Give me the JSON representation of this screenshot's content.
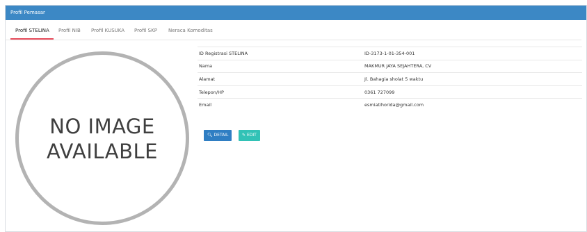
{
  "header": {
    "title": "Profil Pemasar"
  },
  "tabs": [
    {
      "label": "Profil STELINA"
    },
    {
      "label": "Profil NIB"
    },
    {
      "label": "Profil KUSUKA"
    },
    {
      "label": "Profil SKP"
    },
    {
      "label": "Neraca Komoditas"
    }
  ],
  "photo": {
    "line1": "NO IMAGE",
    "line2": "AVAILABLE"
  },
  "info": [
    {
      "label": "ID Registrasi STELINA",
      "value": "ID-3173-1-01-354-001"
    },
    {
      "label": "Nama",
      "value": "MAKMUR JAYA SEJAHTERA, CV"
    },
    {
      "label": "Alamat",
      "value": "Jl. Bahagia sholat 5 waktu"
    },
    {
      "label": "Telepon/HP",
      "value": "0361 727099"
    },
    {
      "label": "Email",
      "value": "esmiatihorida@gmail.com"
    }
  ],
  "buttons": {
    "detail": "DETAIL",
    "edit": "EDIT"
  },
  "colors": {
    "header": "#3c88c5",
    "active_tab": "#e74c5b",
    "detail_btn": "#2f7ec3",
    "edit_btn": "#32c2b6"
  }
}
